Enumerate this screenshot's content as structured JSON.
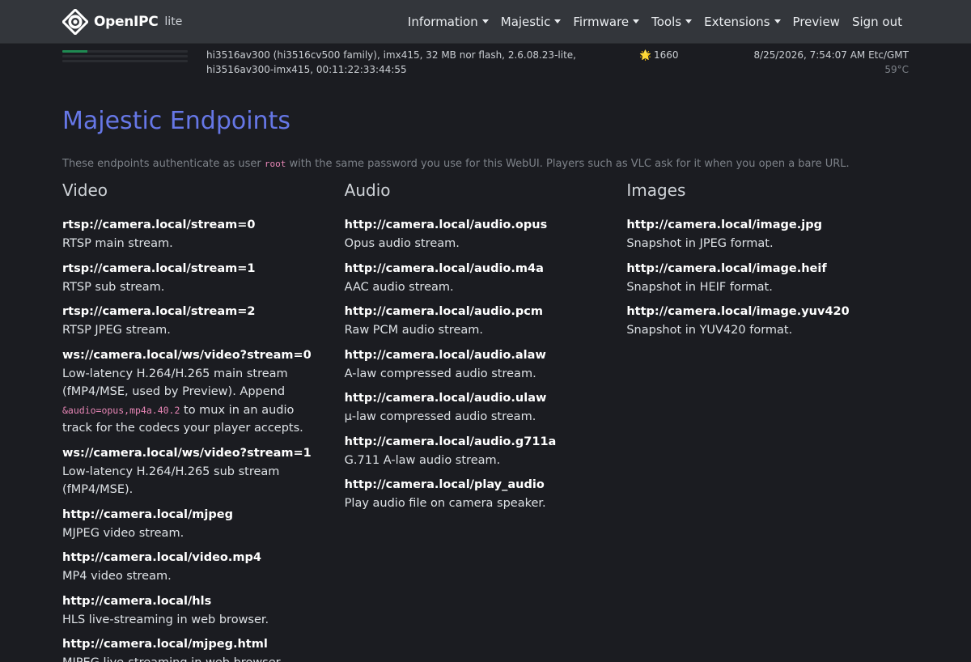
{
  "brand": {
    "name": "OpenIPC",
    "sub": "lite",
    "logo_icon": "openipc-logo-icon"
  },
  "nav": [
    {
      "label": "Information",
      "dropdown": true
    },
    {
      "label": "Majestic",
      "dropdown": true
    },
    {
      "label": "Firmware",
      "dropdown": true
    },
    {
      "label": "Tools",
      "dropdown": true
    },
    {
      "label": "Extensions",
      "dropdown": true
    },
    {
      "label": "Preview",
      "dropdown": false
    },
    {
      "label": "Sign out",
      "dropdown": false
    }
  ],
  "status": {
    "bars": [
      0.2,
      0,
      0
    ],
    "bar_color": "#1f8a52",
    "sysinfo": "hi3516av300 (hi3516cv500 family), imx415, 32 MB nor flash, 2.6.08.23-lite, hi3516av300-imx415, 00:11:22:33:44:55",
    "star": "🌟",
    "uptime": "1660",
    "datetime": "8/25/2026, 7:54:07 AM Etc/GMT",
    "temperature": "59°C"
  },
  "page": {
    "title": "Majestic Endpoints",
    "intro_before": "These endpoints authenticate as user ",
    "intro_user": "root",
    "intro_after": " with the same password you use for this WebUI. Players such as VLC ask for it when you open a bare URL."
  },
  "video": {
    "title": "Video",
    "endpoints": [
      {
        "url": "rtsp://camera.local/stream=0",
        "desc": "RTSP main stream."
      },
      {
        "url": "rtsp://camera.local/stream=1",
        "desc": "RTSP sub stream."
      },
      {
        "url": "rtsp://camera.local/stream=2",
        "desc": "RTSP JPEG stream."
      },
      {
        "url": "ws://camera.local/ws/video?stream=0",
        "desc_before": "Low-latency H.264/H.265 main stream (fMP4/MSE, used by Preview). Append ",
        "desc_code": "&audio=opus,mp4a.40.2",
        "desc_after": " to mux in an audio track for the codecs your player accepts."
      },
      {
        "url": "ws://camera.local/ws/video?stream=1",
        "desc": "Low-latency H.264/H.265 sub stream (fMP4/MSE)."
      },
      {
        "url": "http://camera.local/mjpeg",
        "desc": "MJPEG video stream."
      },
      {
        "url": "http://camera.local/video.mp4",
        "desc": "MP4 video stream."
      },
      {
        "url": "http://camera.local/hls",
        "desc": "HLS live-streaming in web browser."
      },
      {
        "url": "http://camera.local/mjpeg.html",
        "desc": "MJPEG live-streaming in web browser."
      }
    ]
  },
  "audio": {
    "title": "Audio",
    "endpoints": [
      {
        "url": "http://camera.local/audio.opus",
        "desc": "Opus audio stream."
      },
      {
        "url": "http://camera.local/audio.m4a",
        "desc": "AAC audio stream."
      },
      {
        "url": "http://camera.local/audio.pcm",
        "desc": "Raw PCM audio stream."
      },
      {
        "url": "http://camera.local/audio.alaw",
        "desc": "A-law compressed audio stream."
      },
      {
        "url": "http://camera.local/audio.ulaw",
        "desc": "μ-law compressed audio stream."
      },
      {
        "url": "http://camera.local/audio.g711a",
        "desc": "G.711 A-law audio stream."
      },
      {
        "url": "http://camera.local/play_audio",
        "desc": "Play audio file on camera speaker."
      }
    ]
  },
  "images": {
    "title": "Images",
    "endpoints": [
      {
        "url": "http://camera.local/image.jpg",
        "desc": "Snapshot in JPEG format."
      },
      {
        "url": "http://camera.local/image.heif",
        "desc": "Snapshot in HEIF format."
      },
      {
        "url": "http://camera.local/image.yuv420",
        "desc": "Snapshot in YUV420 format."
      }
    ]
  }
}
